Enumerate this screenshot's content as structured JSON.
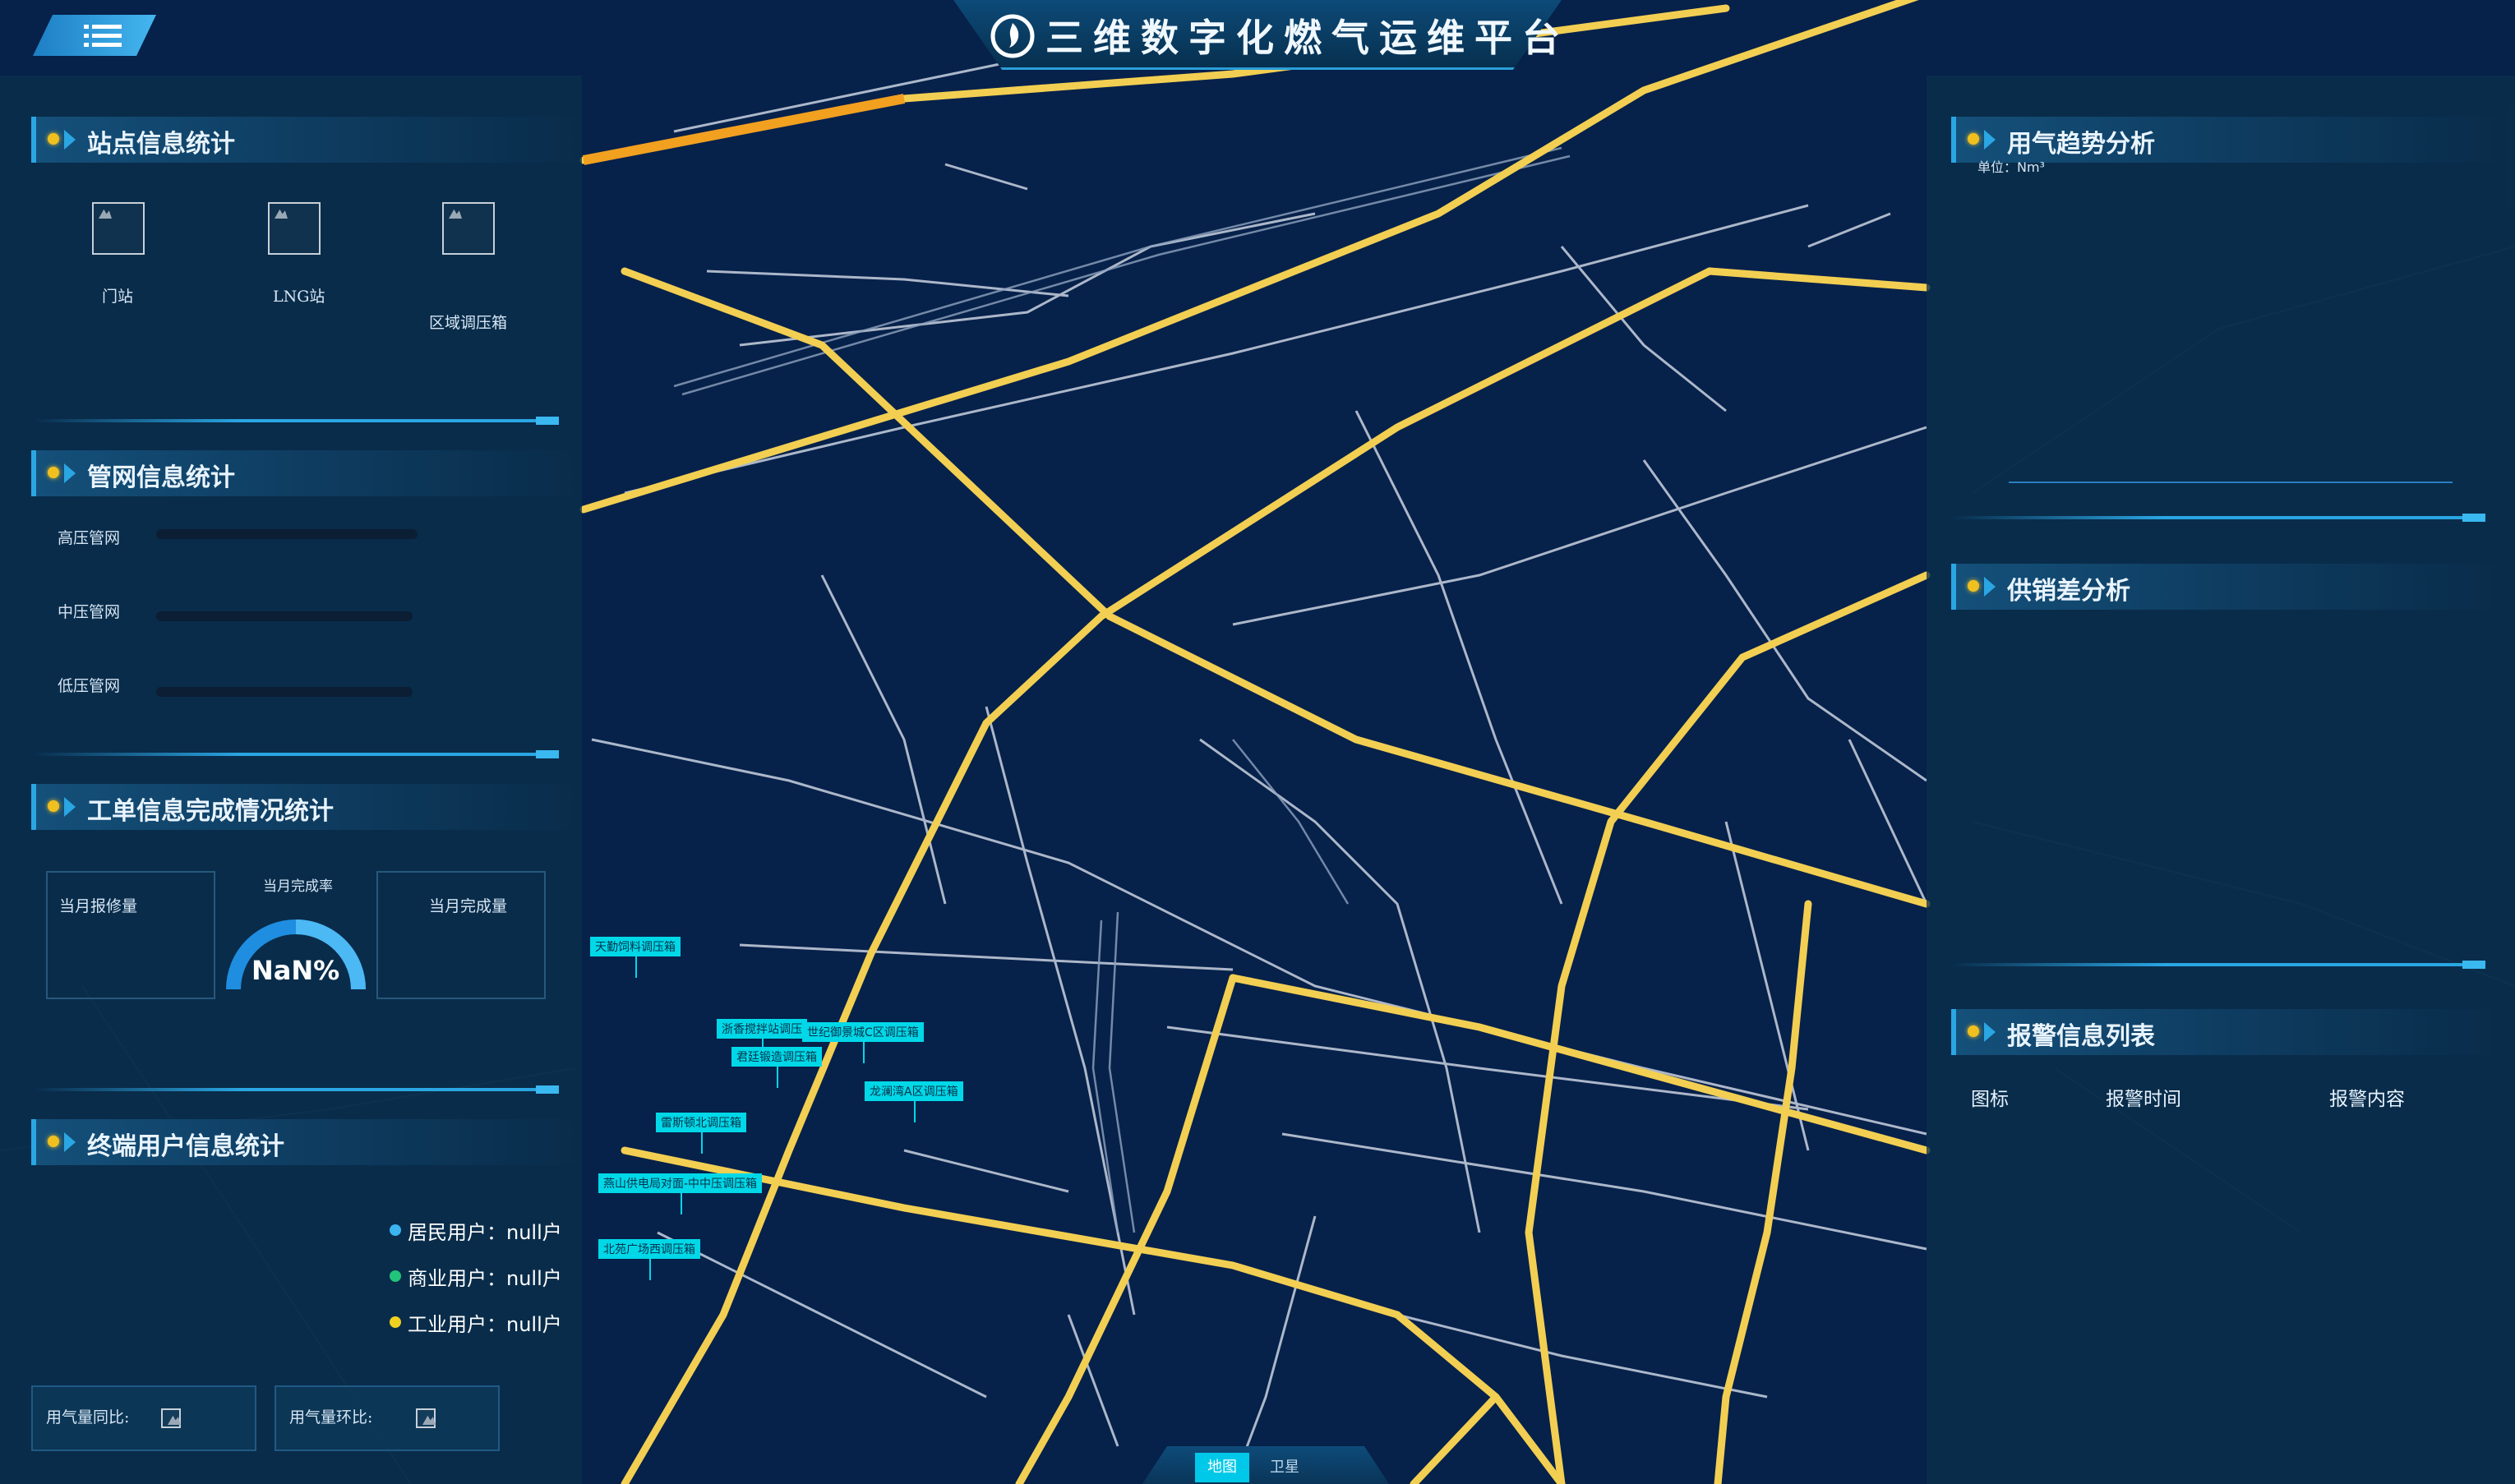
{
  "header": {
    "title": "三维数字化燃气运维平台",
    "logo_icon": "flame-logo-icon",
    "menu_icon": "menu-list-icon"
  },
  "left": {
    "station": {
      "title": "站点信息统计",
      "items": [
        {
          "label": "门站"
        },
        {
          "label": "LNG站"
        },
        {
          "label": "区域调压箱"
        }
      ]
    },
    "pipe": {
      "title": "管网信息统计",
      "items": [
        {
          "label": "高压管网"
        },
        {
          "label": "中压管网"
        },
        {
          "label": "低压管网"
        }
      ]
    },
    "workorder": {
      "title": "工单信息完成情况统计",
      "repair_label": "当月报修量",
      "rate_label": "当月完成率",
      "rate_value": "NaN%",
      "done_label": "当月完成量"
    },
    "users": {
      "title": "终端用户信息统计",
      "items": [
        {
          "label": "居民用户：null户",
          "color": "#3cb4f0"
        },
        {
          "label": "商业用户：null户",
          "color": "#22c47a"
        },
        {
          "label": "工业用户：null户",
          "color": "#f0d020"
        }
      ],
      "yoy_label": "用气量同比:",
      "mom_label": "用气量环比:"
    }
  },
  "right": {
    "trend": {
      "title": "用气趋势分析",
      "unit": "单位：Nm³"
    },
    "supply": {
      "title": "供销差分析"
    },
    "alarm": {
      "title": "报警信息列表",
      "columns": [
        "图标",
        "报警时间",
        "报警内容"
      ]
    }
  },
  "map": {
    "labels": [
      "天勤饲料调压箱",
      "浙香搅拌站调压",
      "世纪御景城C区调压箱",
      "君廷锻造调压箱",
      "龙澜湾A区调压箱",
      "雷斯顿北调压箱",
      "燕山供电局对面-中中压调压箱",
      "北苑广场西调压箱"
    ],
    "tabs": [
      "地图",
      "卫星"
    ]
  }
}
